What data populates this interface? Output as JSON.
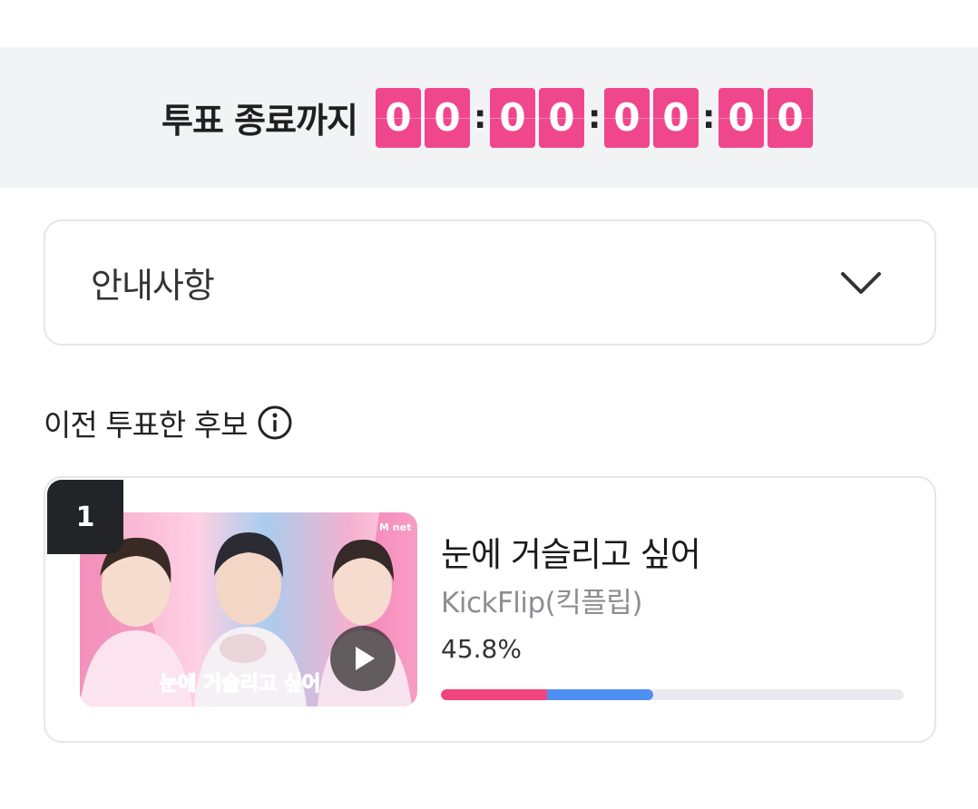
{
  "countdown": {
    "label": "투표 종료까지",
    "digits": [
      "0",
      "0",
      "0",
      "0",
      "0",
      "0",
      "0",
      "0"
    ],
    "separator": ":",
    "accent_color": "#f0468c"
  },
  "notice": {
    "title": "안내사항",
    "icon": "chevron-down-icon"
  },
  "previous_vote": {
    "heading": "이전 투표한 후보",
    "icon": "info-icon"
  },
  "candidate": {
    "rank": "1",
    "thumbnail_text": "눈에 거슬리고 싶어",
    "thumbnail_logo": "M net",
    "song_title": "눈에 거슬리고 싶어",
    "artist": "KickFlip(킥플립)",
    "percent_label": "45.8%",
    "percent_value": 0.458,
    "bar_colors": [
      "#f2447f",
      "#4f8ff2"
    ],
    "play_icon": "play-icon"
  }
}
